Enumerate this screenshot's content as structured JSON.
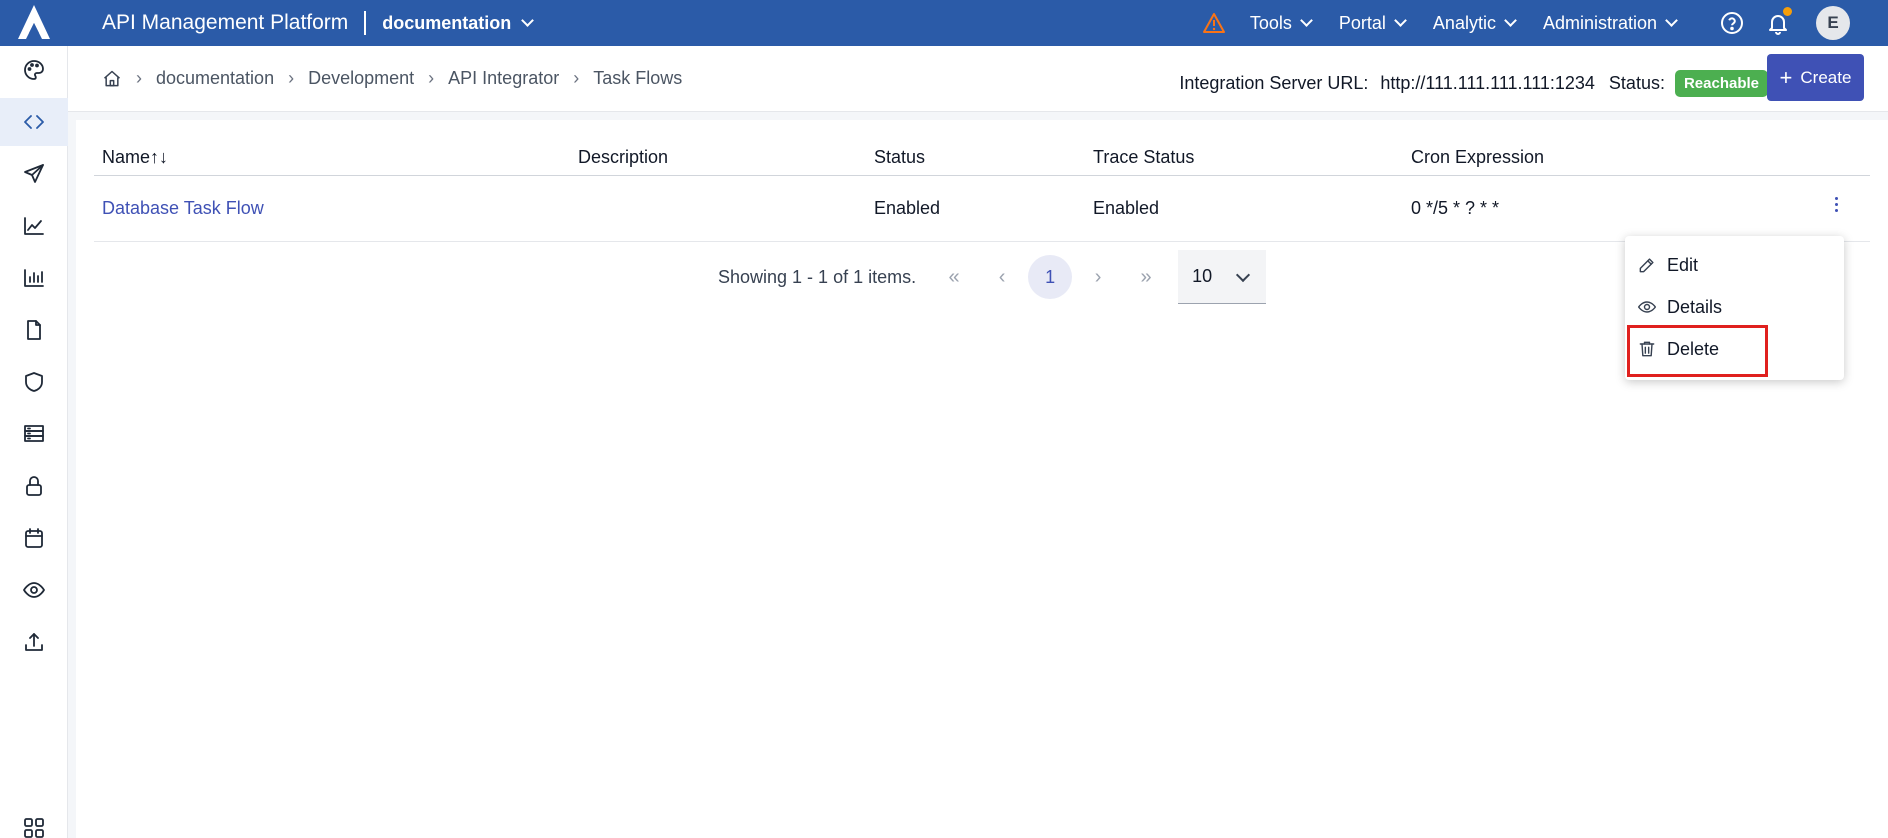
{
  "header": {
    "app_title": "API Management Platform",
    "project": "documentation",
    "menus": [
      "Tools",
      "Portal",
      "Analytic",
      "Administration"
    ],
    "avatar_initial": "E"
  },
  "sidebar": {
    "icons": [
      "palette-icon",
      "code-icon",
      "send-icon",
      "trending-icon",
      "bar-chart-icon",
      "file-icon",
      "shield-icon",
      "server-icon",
      "lock-icon",
      "calendar-icon",
      "eye-icon",
      "upload-icon",
      "apps-grid-icon"
    ],
    "active": "code-icon"
  },
  "breadcrumb": {
    "items": [
      "documentation",
      "Development",
      "API Integrator",
      "Task Flows"
    ]
  },
  "server": {
    "url_label": "Integration Server URL:",
    "url_value": "http://111.111.111.111:1234",
    "status_label": "Status:",
    "status_value": "Reachable",
    "status_color": "#4caf50"
  },
  "create_button": {
    "label": "Create"
  },
  "table": {
    "columns": [
      "Name",
      "Description",
      "Status",
      "Trace Status",
      "Cron Expression"
    ],
    "rows": [
      {
        "name": "Database Task Flow",
        "description": "",
        "status": "Enabled",
        "trace_status": "Enabled",
        "cron": "0 */5 * ? * *"
      }
    ]
  },
  "pagination": {
    "summary": "Showing 1 - 1 of 1 items.",
    "current_page": "1",
    "page_size": "10"
  },
  "action_menu": {
    "items": [
      "Edit",
      "Details",
      "Delete"
    ],
    "highlighted": "Delete"
  },
  "colors": {
    "topbar": "#2b5ba8",
    "accent": "#3f51b5",
    "highlight_border": "#e0201e"
  }
}
